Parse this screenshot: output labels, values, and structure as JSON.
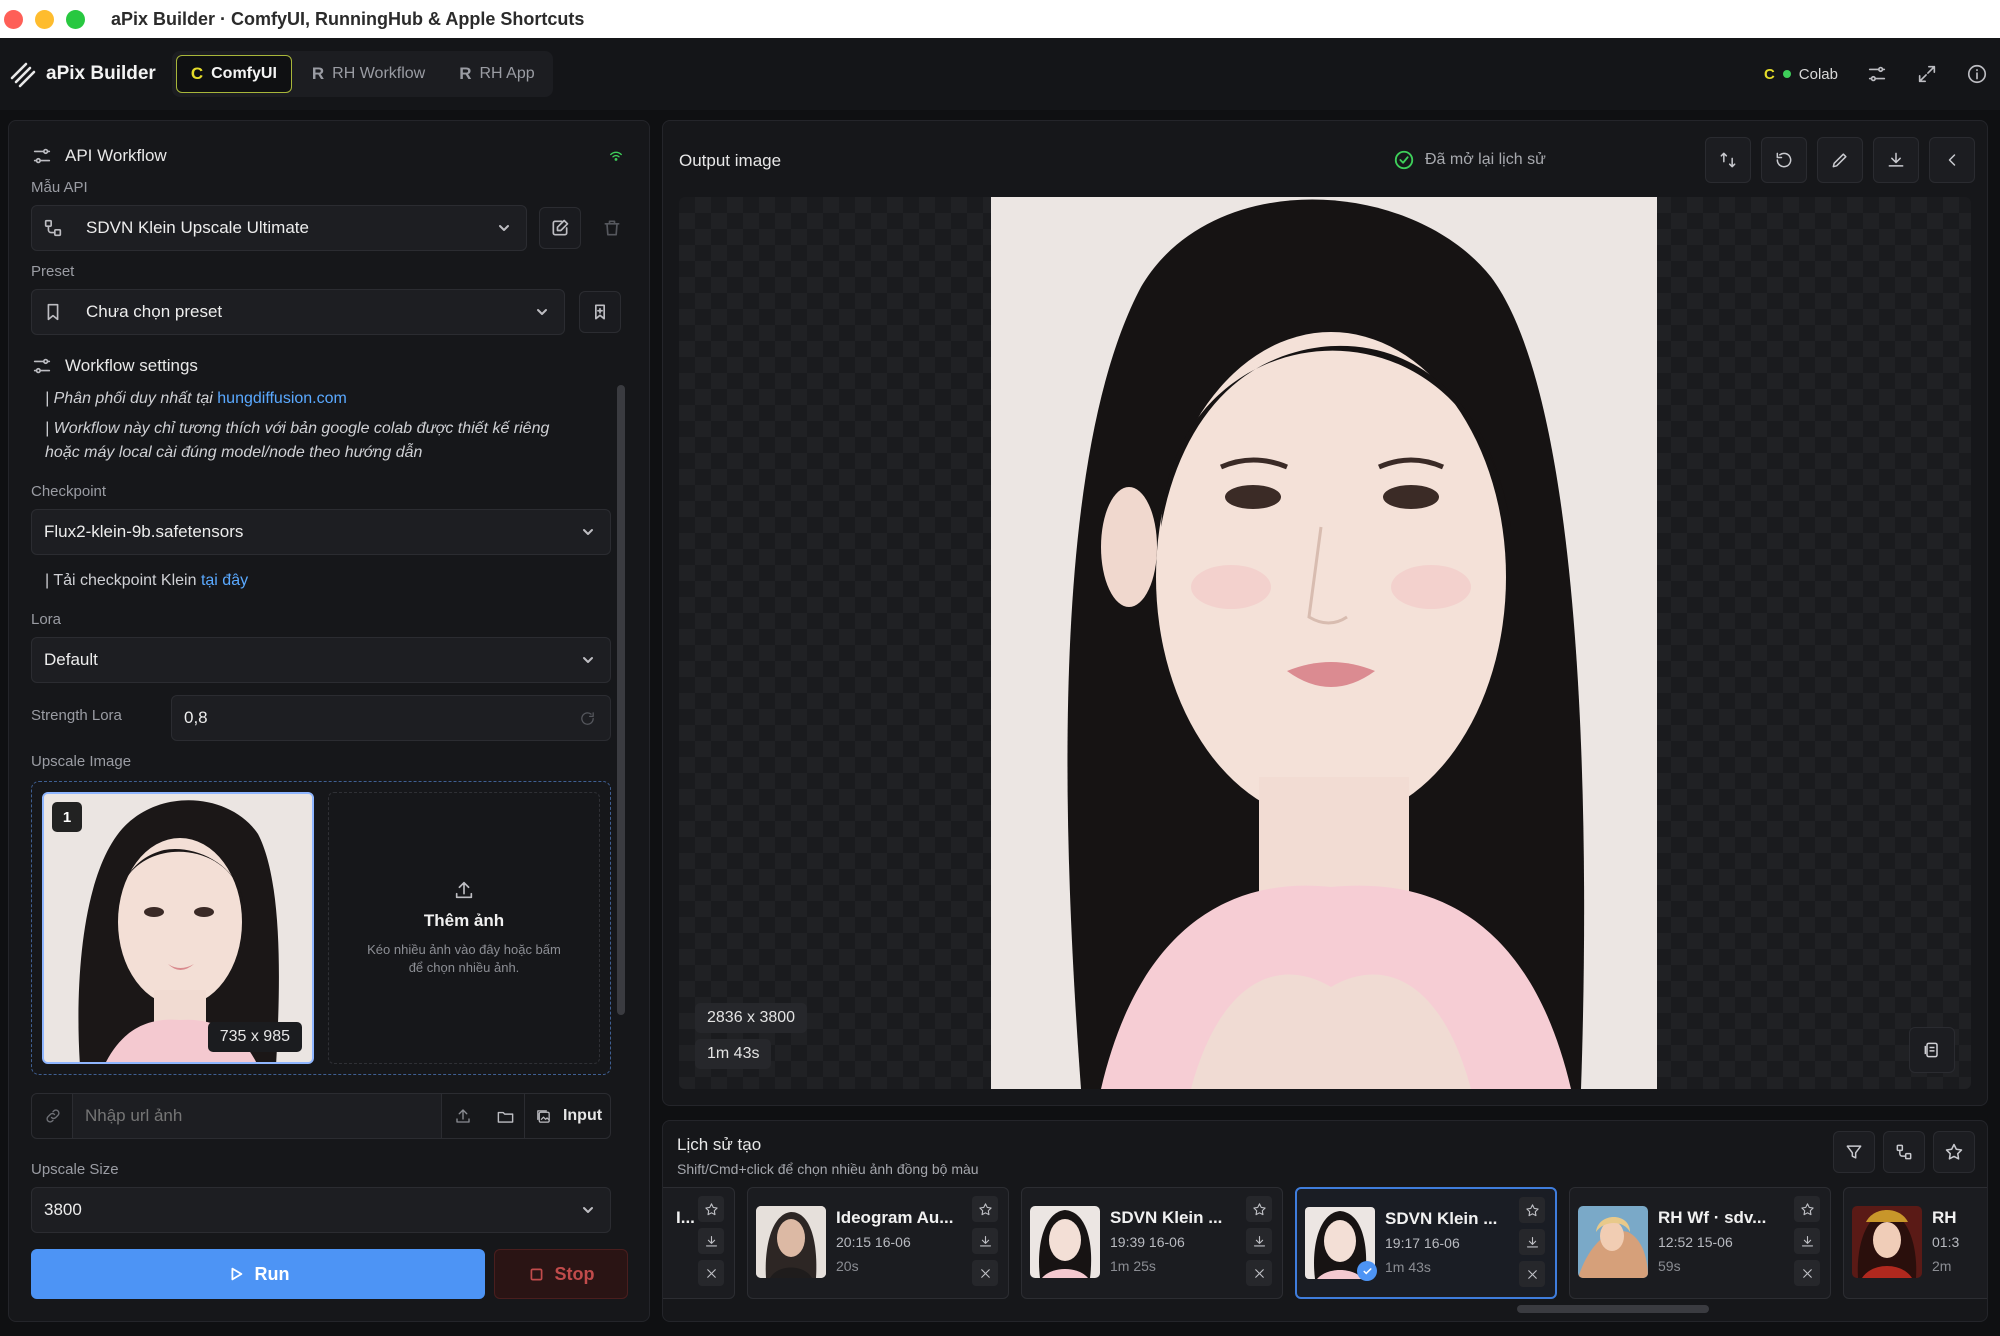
{
  "window": {
    "title": "aPix Builder · ComfyUI, RunningHub & Apple Shortcuts"
  },
  "app": {
    "name": "aPix Builder"
  },
  "modes": [
    {
      "label": "ComfyUI",
      "glyph": "C",
      "active": true
    },
    {
      "label": "RH Workflow",
      "glyph": "R",
      "active": false
    },
    {
      "label": "RH App",
      "glyph": "R",
      "active": false
    }
  ],
  "header_right": {
    "colab_label": "Colab",
    "status_color": "#3ecf5a"
  },
  "left": {
    "section_title": "API Workflow",
    "api_label": "Mẫu API",
    "api_value": "SDVN Klein Upscale Ultimate",
    "preset_label": "Preset",
    "preset_value": "Chưa chọn preset",
    "settings_title": "Workflow settings",
    "note1_prefix": "| Phân phối duy nhất tại ",
    "note1_link": "hungdiffusion.com",
    "note2_line1": "| Workflow này chỉ tương thích với bản google colab được thiết kế riêng",
    "note2_line2": "hoặc máy local cài đúng model/node theo hướng dẫn",
    "checkpoint_label": "Checkpoint",
    "checkpoint_value": "Flux2-klein-9b.safetensors",
    "checkpoint_note_prefix": "| Tải checkpoint Klein ",
    "checkpoint_note_link": "tại đây",
    "lora_label": "Lora",
    "lora_value": "Default",
    "strength_label": "Strength Lora",
    "strength_value": "0,8",
    "upscale_image_label": "Upscale Image",
    "image_index": "1",
    "image_size": "735 x 985",
    "add_title": "Thêm ảnh",
    "add_hint": "Kéo nhiều ảnh vào đây hoặc bấm để chọn nhiều ảnh.",
    "url_placeholder": "Nhập url ảnh",
    "input_button": "Input",
    "upscale_size_label": "Upscale Size",
    "upscale_size_value": "3800",
    "run_label": "Run",
    "stop_label": "Stop"
  },
  "output": {
    "title": "Output image",
    "status": "Đã mở lại lịch sử",
    "dims": "2836 x 3800",
    "duration": "1m 43s"
  },
  "history": {
    "title": "Lịch sử tạo",
    "subtitle": "Shift/Cmd+click để chọn nhiều ảnh đồng bộ màu",
    "items": [
      {
        "name": "I...",
        "time": "",
        "dur": "",
        "selected": false,
        "tone": "#2a2b2f"
      },
      {
        "name": "Ideogram Au...",
        "time": "20:15 16-06",
        "dur": "20s",
        "selected": false,
        "tone": "#3a3633"
      },
      {
        "name": "SDVN Klein ...",
        "time": "19:39 16-06",
        "dur": "1m 25s",
        "selected": false,
        "tone": "#ece6e3"
      },
      {
        "name": "SDVN Klein ...",
        "time": "19:17 16-06",
        "dur": "1m 43s",
        "selected": true,
        "tone": "#ece6e3"
      },
      {
        "name": "RH Wf · sdv...",
        "time": "12:52 15-06",
        "dur": "59s",
        "selected": false,
        "tone": "#b98a6a"
      },
      {
        "name": "RH",
        "time": "01:3",
        "dur": "2m",
        "selected": false,
        "tone": "#8a2a22"
      }
    ]
  }
}
